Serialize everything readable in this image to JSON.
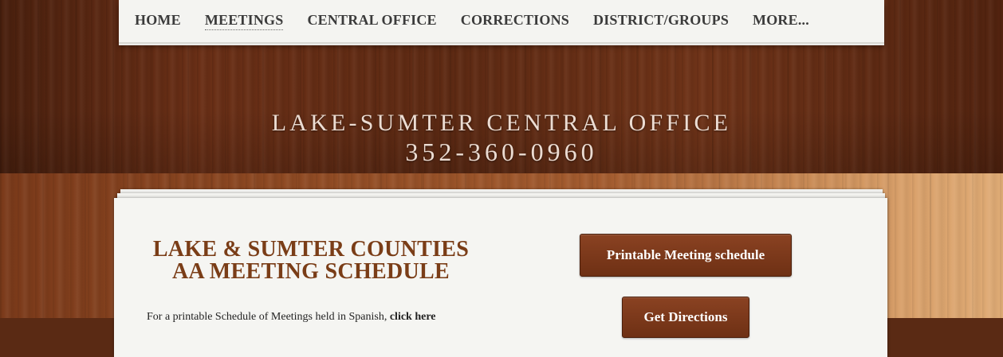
{
  "nav": {
    "items": [
      {
        "label": "HOME",
        "active": false
      },
      {
        "label": "MEETINGS",
        "active": true
      },
      {
        "label": "CENTRAL OFFICE",
        "active": false
      },
      {
        "label": "CORRECTIONS",
        "active": false
      },
      {
        "label": "DISTRICT/GROUPS",
        "active": false
      },
      {
        "label": "MORE...",
        "active": false
      }
    ]
  },
  "header": {
    "title": "LAKE-SUMTER CENTRAL OFFICE",
    "phone": "352-360-0960"
  },
  "content": {
    "title_line1": "LAKE & SUMTER COUNTIES",
    "title_line2": "AA MEETING SCHEDULE",
    "spanish_text": "For a printable Schedule of Meetings held in Spanish, ",
    "spanish_link": "click here",
    "buttons": {
      "printable": "Printable Meeting schedule",
      "directions": "Get Directions"
    }
  },
  "colors": {
    "accent": "#7a3d17",
    "button": "#7a3818",
    "nav_bg": "#f4f4f1",
    "header_text": "#ecdcd2"
  }
}
